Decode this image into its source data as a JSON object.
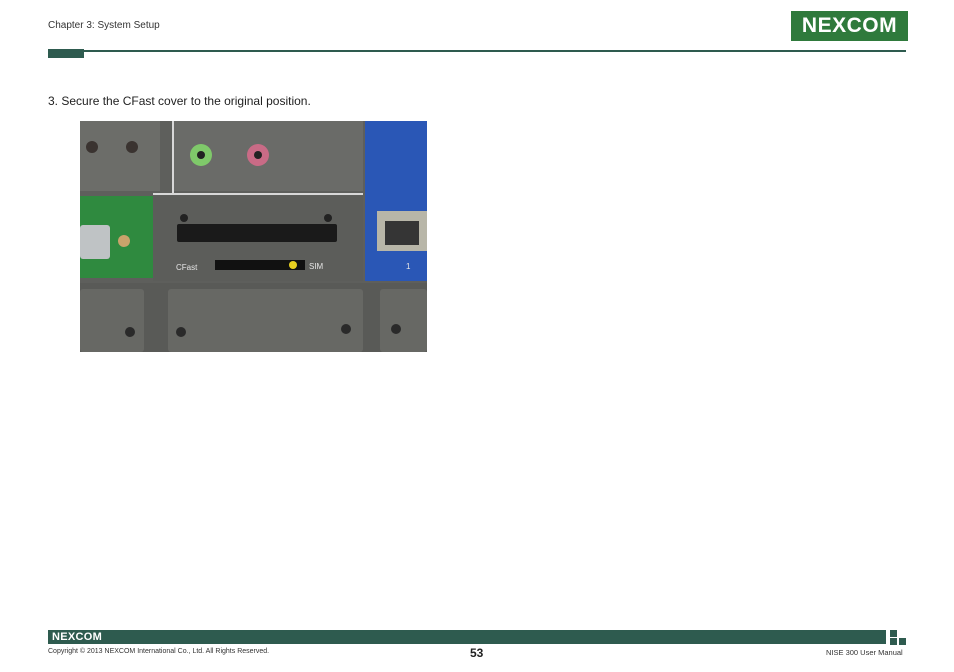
{
  "header": {
    "chapter": "Chapter 3: System Setup",
    "logo_text": "NEXCOM"
  },
  "content": {
    "step": "3. Secure the CFast cover to the original position.",
    "photo": {
      "cfast_label": "CFast",
      "sim_label": "SIM",
      "lan_label": "1"
    }
  },
  "footer": {
    "logo_text": "NEXCOM",
    "copyright": "Copyright © 2013 NEXCOM International Co., Ltd. All Rights Reserved.",
    "page_number": "53",
    "manual_title": "NISE 300 User Manual"
  },
  "colors": {
    "brand_green": "#2f7a3c",
    "bar_green": "#2e5b4f"
  }
}
